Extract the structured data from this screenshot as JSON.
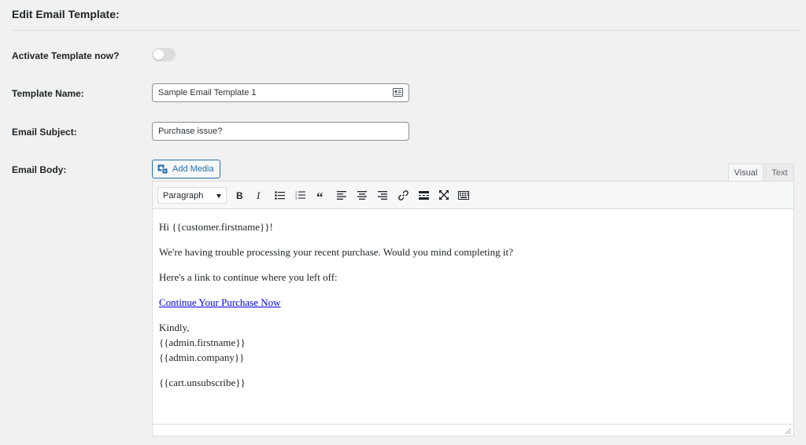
{
  "page": {
    "title": "Edit Email Template:"
  },
  "fields": {
    "activate_label": "Activate Template now?",
    "activate_on": false,
    "name_label": "Template Name:",
    "name_value": "Sample Email Template 1",
    "subject_label": "Email Subject:",
    "subject_value": "Purchase issue?",
    "body_label": "Email Body:"
  },
  "editor": {
    "add_media_label": "Add Media",
    "tabs": {
      "visual": "Visual",
      "text": "Text"
    },
    "format_value": "Paragraph",
    "toolbar_icons": [
      "bold-icon",
      "italic-icon",
      "bulleted-list-icon",
      "numbered-list-icon",
      "blockquote-icon",
      "align-left-icon",
      "align-center-icon",
      "align-right-icon",
      "insert-link-icon",
      "read-more-icon",
      "fullscreen-icon",
      "toolbar-toggle-icon"
    ],
    "body": {
      "greeting": "Hi {{customer.firstname}}!",
      "line1": "We're having trouble processing your recent purchase. Would you mind completing it?",
      "line2": "Here's a link to continue where you left off:",
      "link_text": "Continue Your Purchase Now",
      "sign_off": "Kindly,",
      "sig_name": "{{admin.firstname}}",
      "sig_company": "{{admin.company}}",
      "unsubscribe": "{{cart.unsubscribe}}"
    }
  },
  "colors": {
    "accent": "#2271b1",
    "link": "#0000ee",
    "toggle_off": "#dcdcde"
  }
}
